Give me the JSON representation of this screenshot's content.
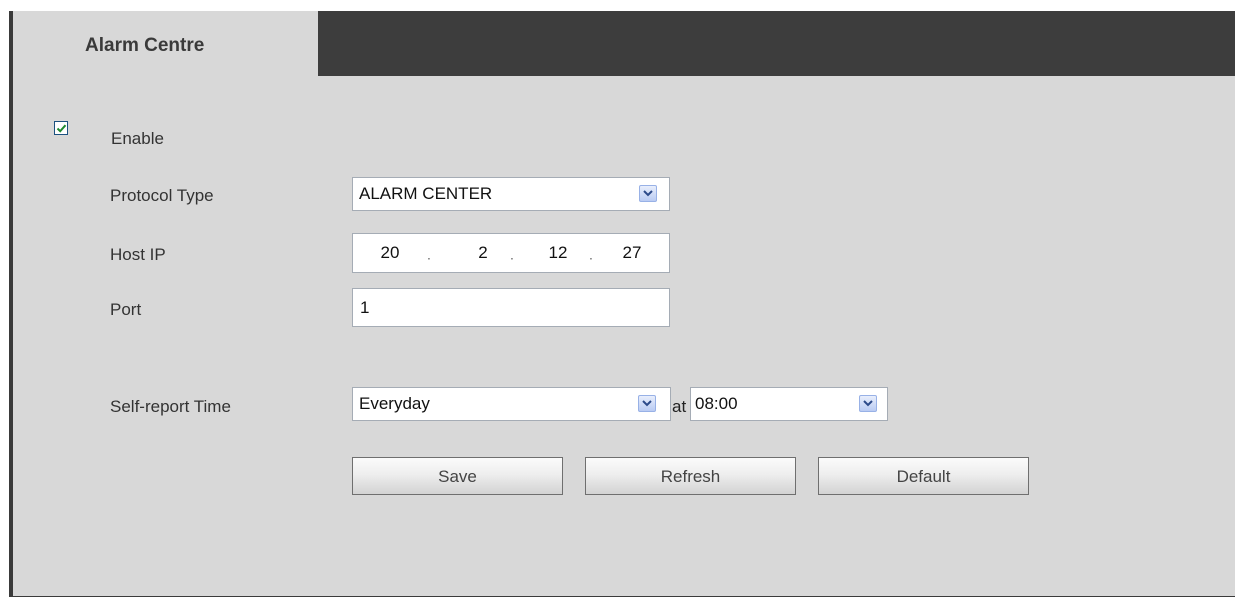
{
  "tab": {
    "title": "Alarm Centre"
  },
  "form": {
    "enable": {
      "label": "Enable",
      "checked": true
    },
    "protocol_type": {
      "label": "Protocol Type",
      "value": "ALARM CENTER"
    },
    "host_ip": {
      "label": "Host IP",
      "octets": [
        "20",
        "2",
        "12",
        "27"
      ]
    },
    "port": {
      "label": "Port",
      "value": "1"
    },
    "self_report": {
      "label": "Self-report Time",
      "day_value": "Everyday",
      "at_label": "at",
      "time_value": "08:00"
    }
  },
  "buttons": {
    "save": "Save",
    "refresh": "Refresh",
    "default": "Default"
  },
  "colors": {
    "tabbar": "#3d3d3d",
    "panel": "#d8d8d8",
    "checkmark": "#1f8a2f",
    "dropdown_accent": "#98b1e6"
  },
  "icons": {
    "checkbox": "check-icon",
    "dropdown": "chevron-down-icon"
  }
}
